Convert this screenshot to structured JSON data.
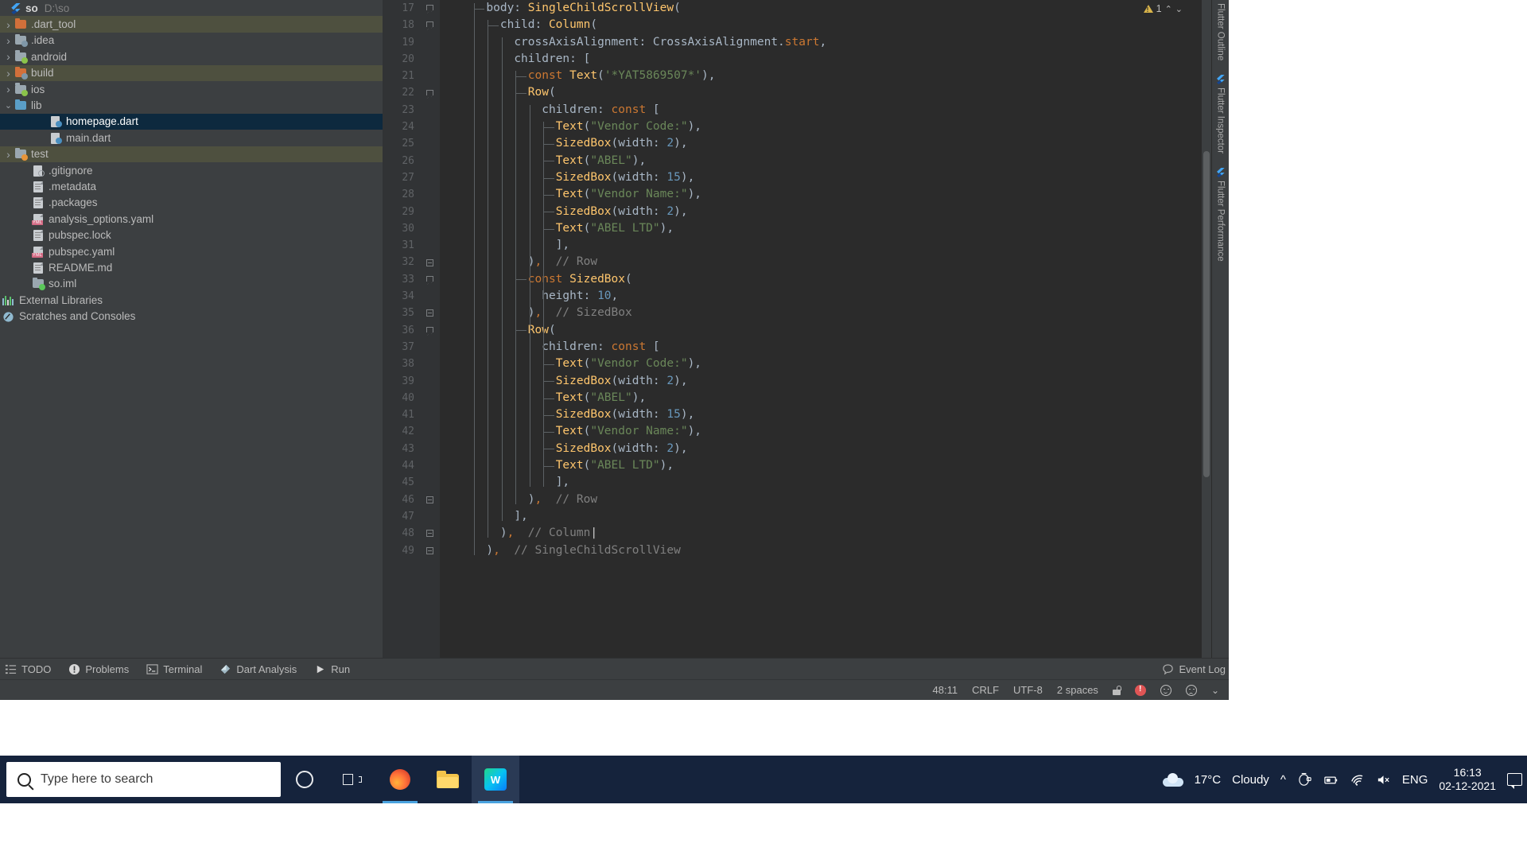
{
  "project": {
    "title": "so",
    "path": "D:\\so",
    "logo_icon": "flutter-logo-icon",
    "items": [
      {
        "label": ".dart_tool",
        "icon": "folder-orange-icon",
        "arrow": "chevron-right-icon",
        "indent": 0,
        "state": "hover"
      },
      {
        "label": ".idea",
        "icon": "folder-gray-fan-icon",
        "arrow": "chevron-right-icon",
        "indent": 0,
        "state": "none"
      },
      {
        "label": "android",
        "icon": "folder-gray-android-icon",
        "arrow": "chevron-right-icon",
        "indent": 0,
        "state": "none"
      },
      {
        "label": "build",
        "icon": "folder-orange-fan-icon",
        "arrow": "chevron-right-icon",
        "indent": 0,
        "state": "hover"
      },
      {
        "label": "ios",
        "icon": "folder-gray-ios-icon",
        "arrow": "chevron-right-icon",
        "indent": 0,
        "state": "none"
      },
      {
        "label": "lib",
        "icon": "folder-blue-icon",
        "arrow": "chevron-down-icon",
        "indent": 0,
        "state": "none"
      },
      {
        "label": "homepage.dart",
        "icon": "dart-file-icon",
        "arrow": "",
        "indent": 2,
        "state": "selected"
      },
      {
        "label": "main.dart",
        "icon": "dart-file-icon",
        "arrow": "",
        "indent": 2,
        "state": "none"
      },
      {
        "label": "test",
        "icon": "folder-gray-test-icon",
        "arrow": "chevron-right-icon",
        "indent": 0,
        "state": "hover"
      },
      {
        "label": ".gitignore",
        "icon": "gitignore-file-icon",
        "arrow": "",
        "indent": 1,
        "state": "none"
      },
      {
        "label": ".metadata",
        "icon": "text-file-icon",
        "arrow": "",
        "indent": 1,
        "state": "none"
      },
      {
        "label": ".packages",
        "icon": "text-file-icon",
        "arrow": "",
        "indent": 1,
        "state": "none"
      },
      {
        "label": "analysis_options.yaml",
        "icon": "yaml-file-icon",
        "arrow": "",
        "indent": 1,
        "state": "none"
      },
      {
        "label": "pubspec.lock",
        "icon": "text-file-icon",
        "arrow": "",
        "indent": 1,
        "state": "none"
      },
      {
        "label": "pubspec.yaml",
        "icon": "yaml-file-icon",
        "arrow": "",
        "indent": 1,
        "state": "none"
      },
      {
        "label": "README.md",
        "icon": "text-file-icon",
        "arrow": "",
        "indent": 1,
        "state": "none"
      },
      {
        "label": "so.iml",
        "icon": "module-folder-icon",
        "arrow": "",
        "indent": 1,
        "state": "none"
      },
      {
        "label": "External Libraries",
        "icon": "libraries-bars-icon",
        "arrow": "",
        "indent": -1,
        "state": "none"
      },
      {
        "label": "Scratches and Consoles",
        "icon": "scratches-icon",
        "arrow": "",
        "indent": -1,
        "state": "none"
      }
    ]
  },
  "editor": {
    "warning_count": "1",
    "warning_icon": "warning-triangle-icon",
    "chevron_up_icon": "chevron-up-icon",
    "chevron_down_icon": "chevron-down-icon",
    "first_line": 17,
    "lines": [
      {
        "n": 17,
        "fold": "collapse",
        "indent": 3,
        "tick": true,
        "tokens": [
          [
            "pln",
            "body: "
          ],
          [
            "cls",
            "SingleChildScrollView"
          ],
          [
            "pln",
            "("
          ]
        ]
      },
      {
        "n": 18,
        "fold": "collapse",
        "indent": 4,
        "tick": true,
        "tokens": [
          [
            "pln",
            "child: "
          ],
          [
            "cls",
            "Column"
          ],
          [
            "pln",
            "("
          ]
        ]
      },
      {
        "n": 19,
        "fold": "",
        "indent": 5,
        "tick": false,
        "tokens": [
          [
            "pln",
            "crossAxisAlignment: CrossAxisAlignment."
          ],
          [
            "kw",
            "start"
          ],
          [
            "pln",
            ","
          ]
        ]
      },
      {
        "n": 20,
        "fold": "",
        "indent": 5,
        "tick": false,
        "tokens": [
          [
            "pln",
            "children: ["
          ]
        ]
      },
      {
        "n": 21,
        "fold": "",
        "indent": 6,
        "tick": true,
        "tokens": [
          [
            "kw",
            "const "
          ],
          [
            "cls",
            "Text"
          ],
          [
            "pln",
            "("
          ],
          [
            "str",
            "'*YAT5869507*'"
          ],
          [
            "pln",
            "),"
          ]
        ]
      },
      {
        "n": 22,
        "fold": "collapse",
        "indent": 6,
        "tick": true,
        "tokens": [
          [
            "cls",
            "Row"
          ],
          [
            "pln",
            "("
          ]
        ]
      },
      {
        "n": 23,
        "fold": "",
        "indent": 7,
        "tick": false,
        "tokens": [
          [
            "pln",
            "children: "
          ],
          [
            "kw",
            "const "
          ],
          [
            "pln",
            "["
          ]
        ]
      },
      {
        "n": 24,
        "fold": "",
        "indent": 8,
        "tick": true,
        "tokens": [
          [
            "cls",
            "Text"
          ],
          [
            "pln",
            "("
          ],
          [
            "str",
            "\"Vendor Code:\""
          ],
          [
            "pln",
            "),"
          ]
        ]
      },
      {
        "n": 25,
        "fold": "",
        "indent": 8,
        "tick": true,
        "tokens": [
          [
            "cls",
            "SizedBox"
          ],
          [
            "pln",
            "(width: "
          ],
          [
            "num",
            "2"
          ],
          [
            "pln",
            "),"
          ]
        ]
      },
      {
        "n": 26,
        "fold": "",
        "indent": 8,
        "tick": true,
        "tokens": [
          [
            "cls",
            "Text"
          ],
          [
            "pln",
            "("
          ],
          [
            "str",
            "\"ABEL\""
          ],
          [
            "pln",
            "),"
          ]
        ]
      },
      {
        "n": 27,
        "fold": "",
        "indent": 8,
        "tick": true,
        "tokens": [
          [
            "cls",
            "SizedBox"
          ],
          [
            "pln",
            "(width: "
          ],
          [
            "num",
            "15"
          ],
          [
            "pln",
            "),"
          ]
        ]
      },
      {
        "n": 28,
        "fold": "",
        "indent": 8,
        "tick": true,
        "tokens": [
          [
            "cls",
            "Text"
          ],
          [
            "pln",
            "("
          ],
          [
            "str",
            "\"Vendor Name:\""
          ],
          [
            "pln",
            "),"
          ]
        ]
      },
      {
        "n": 29,
        "fold": "",
        "indent": 8,
        "tick": true,
        "tokens": [
          [
            "cls",
            "SizedBox"
          ],
          [
            "pln",
            "(width: "
          ],
          [
            "num",
            "2"
          ],
          [
            "pln",
            "),"
          ]
        ]
      },
      {
        "n": 30,
        "fold": "",
        "indent": 8,
        "tick": true,
        "tokens": [
          [
            "cls",
            "Text"
          ],
          [
            "pln",
            "("
          ],
          [
            "str",
            "\"ABEL LTD\""
          ],
          [
            "pln",
            "),"
          ]
        ]
      },
      {
        "n": 31,
        "fold": "",
        "indent": 8,
        "tick": false,
        "tokens": [
          [
            "pln",
            "],"
          ]
        ]
      },
      {
        "n": 32,
        "fold": "expand",
        "indent": 6,
        "tick": false,
        "tokens": [
          [
            "pln",
            ")"
          ],
          [
            "kw",
            ","
          ],
          [
            "cmt",
            "  // Row"
          ]
        ]
      },
      {
        "n": 33,
        "fold": "collapse",
        "indent": 6,
        "tick": true,
        "tokens": [
          [
            "kw",
            "const "
          ],
          [
            "cls",
            "SizedBox"
          ],
          [
            "pln",
            "("
          ]
        ]
      },
      {
        "n": 34,
        "fold": "",
        "indent": 7,
        "tick": false,
        "tokens": [
          [
            "pln",
            "height: "
          ],
          [
            "num",
            "10"
          ],
          [
            "pln",
            ","
          ]
        ]
      },
      {
        "n": 35,
        "fold": "expand",
        "indent": 6,
        "tick": false,
        "tokens": [
          [
            "pln",
            ")"
          ],
          [
            "kw",
            ","
          ],
          [
            "cmt",
            "  // SizedBox"
          ]
        ]
      },
      {
        "n": 36,
        "fold": "collapse",
        "indent": 6,
        "tick": true,
        "tokens": [
          [
            "cls",
            "Row"
          ],
          [
            "pln",
            "("
          ]
        ]
      },
      {
        "n": 37,
        "fold": "",
        "indent": 7,
        "tick": false,
        "tokens": [
          [
            "pln",
            "children: "
          ],
          [
            "kw",
            "const "
          ],
          [
            "pln",
            "["
          ]
        ]
      },
      {
        "n": 38,
        "fold": "",
        "indent": 8,
        "tick": true,
        "tokens": [
          [
            "cls",
            "Text"
          ],
          [
            "pln",
            "("
          ],
          [
            "str",
            "\"Vendor Code:\""
          ],
          [
            "pln",
            "),"
          ]
        ]
      },
      {
        "n": 39,
        "fold": "",
        "indent": 8,
        "tick": true,
        "tokens": [
          [
            "cls",
            "SizedBox"
          ],
          [
            "pln",
            "(width: "
          ],
          [
            "num",
            "2"
          ],
          [
            "pln",
            "),"
          ]
        ]
      },
      {
        "n": 40,
        "fold": "",
        "indent": 8,
        "tick": true,
        "tokens": [
          [
            "cls",
            "Text"
          ],
          [
            "pln",
            "("
          ],
          [
            "str",
            "\"ABEL\""
          ],
          [
            "pln",
            "),"
          ]
        ]
      },
      {
        "n": 41,
        "fold": "",
        "indent": 8,
        "tick": true,
        "tokens": [
          [
            "cls",
            "SizedBox"
          ],
          [
            "pln",
            "(width: "
          ],
          [
            "num",
            "15"
          ],
          [
            "pln",
            "),"
          ]
        ]
      },
      {
        "n": 42,
        "fold": "",
        "indent": 8,
        "tick": true,
        "tokens": [
          [
            "cls",
            "Text"
          ],
          [
            "pln",
            "("
          ],
          [
            "str",
            "\"Vendor Name:\""
          ],
          [
            "pln",
            "),"
          ]
        ]
      },
      {
        "n": 43,
        "fold": "",
        "indent": 8,
        "tick": true,
        "tokens": [
          [
            "cls",
            "SizedBox"
          ],
          [
            "pln",
            "(width: "
          ],
          [
            "num",
            "2"
          ],
          [
            "pln",
            "),"
          ]
        ]
      },
      {
        "n": 44,
        "fold": "",
        "indent": 8,
        "tick": true,
        "tokens": [
          [
            "cls",
            "Text"
          ],
          [
            "pln",
            "("
          ],
          [
            "str",
            "\"ABEL LTD\""
          ],
          [
            "pln",
            "),"
          ]
        ]
      },
      {
        "n": 45,
        "fold": "",
        "indent": 8,
        "tick": false,
        "tokens": [
          [
            "pln",
            "],"
          ]
        ]
      },
      {
        "n": 46,
        "fold": "expand",
        "indent": 6,
        "tick": false,
        "tokens": [
          [
            "pln",
            ")"
          ],
          [
            "kw",
            ","
          ],
          [
            "cmt",
            "  // Row"
          ]
        ]
      },
      {
        "n": 47,
        "fold": "",
        "indent": 5,
        "tick": false,
        "tokens": [
          [
            "pln",
            "],"
          ]
        ]
      },
      {
        "n": 48,
        "fold": "expand",
        "indent": 4,
        "tick": false,
        "tokens": [
          [
            "pln",
            ")"
          ],
          [
            "kw",
            ","
          ],
          [
            "cmt",
            "  // Column"
          ]
        ],
        "caret": true
      },
      {
        "n": 49,
        "fold": "expand",
        "indent": 3,
        "tick": false,
        "tokens": [
          [
            "pln",
            ")"
          ],
          [
            "kw",
            ","
          ],
          [
            "cmt",
            "  // SingleChildScrollView"
          ]
        ]
      }
    ]
  },
  "right_strip": {
    "tabs": [
      {
        "label": "Flutter Outline",
        "icon": ""
      },
      {
        "label": "Flutter Inspector",
        "icon": "flutter-logo-icon"
      },
      {
        "label": "Flutter Performance",
        "icon": "flutter-logo-icon"
      }
    ]
  },
  "tool_window_bar": {
    "items": [
      {
        "label": "TODO",
        "icon": "todo-list-icon"
      },
      {
        "label": "Problems",
        "icon": "problems-exclamation-icon"
      },
      {
        "label": "Terminal",
        "icon": "terminal-icon"
      },
      {
        "label": "Dart Analysis",
        "icon": "dart-analysis-icon"
      },
      {
        "label": "Run",
        "icon": "run-play-icon"
      }
    ],
    "event_log": {
      "label": "Event Log",
      "icon": "event-log-icon"
    }
  },
  "status_bar": {
    "caret_position": "48:11",
    "line_separator": "CRLF",
    "encoding": "UTF-8",
    "indent": "2 spaces",
    "lock_icon": "unlocked-padlock-icon",
    "error_icon": "error-circle-icon",
    "smile_icon": "happy-face-icon",
    "frown_icon": "sad-face-icon",
    "chevron_icon": "chevron-down-icon"
  },
  "taskbar": {
    "search_placeholder": "Type here to search",
    "search_icon": "search-magnifier-icon",
    "buttons": [
      {
        "name": "cortana-button",
        "icon": "cortana-circle-icon"
      },
      {
        "name": "task-view-button",
        "icon": "task-view-icon"
      },
      {
        "name": "firefox-button",
        "icon": "firefox-icon"
      },
      {
        "name": "file-explorer-button",
        "icon": "file-explorer-icon"
      },
      {
        "name": "webstorm-button",
        "icon": "android-studio-icon"
      }
    ],
    "weather": {
      "temperature": "17°C",
      "condition": "Cloudy",
      "icon": "cloud-icon"
    },
    "tray": {
      "show_hidden_icon": "chevron-up-icon",
      "icons": [
        "screen-share-icon",
        "battery-icon",
        "wifi-icon",
        "volume-muted-icon"
      ],
      "language": "ENG"
    },
    "clock": {
      "time": "16:13",
      "date": "02-12-2021"
    },
    "notifications_icon": "notification-speech-icon"
  },
  "colors": {
    "ide_chrome": "#3c3f41",
    "editor_bg": "#2b2b2b",
    "selection_blue": "#0d293e",
    "keyword": "#cc7832",
    "class_name": "#ffc66d",
    "string": "#6a8759",
    "number": "#6897bb",
    "comment": "#808080",
    "plain": "#a9b7c6",
    "taskbar": "#15233c"
  }
}
